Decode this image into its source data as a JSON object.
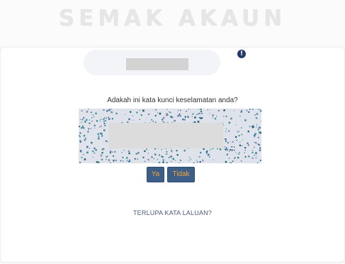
{
  "header": {
    "title": "SEMAK AKAUN"
  },
  "account": {
    "info_icon_glyph": "!"
  },
  "security": {
    "question": "Adakah ini kata kunci keselamatan anda?"
  },
  "actions": {
    "yes_label": "Ya",
    "no_label": "Tidak"
  },
  "links": {
    "forgot_password": "TERLUPA KATA LALUAN?"
  },
  "colors": {
    "button_bg": "#3d5e86",
    "button_text": "#f0a73c",
    "title_text": "#e6e6e6",
    "info_icon": "#233a6b"
  }
}
